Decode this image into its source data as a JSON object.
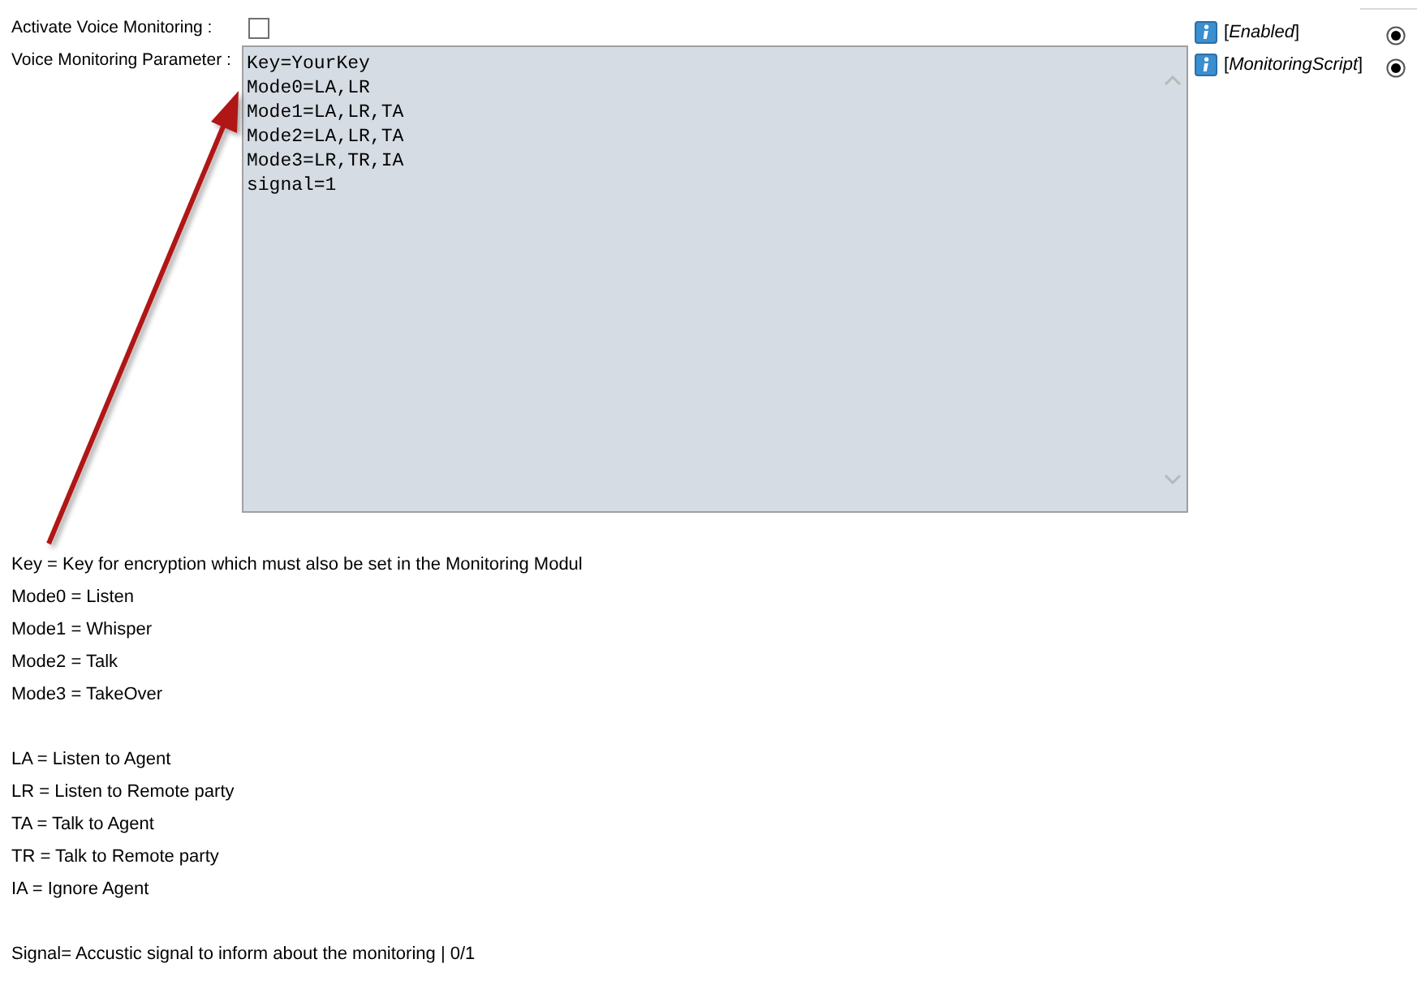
{
  "fields": [
    {
      "kind": "checkbox",
      "label": "Activate Voice Monitoring :",
      "checked": false,
      "binding": "[*Enabled*]",
      "radio_selected": true
    },
    {
      "kind": "textarea",
      "label": "Voice Monitoring Parameter :",
      "value": "Key=YourKey\nMode0=LA,LR\nMode1=LA,LR,TA\nMode2=LA,LR,TA\nMode3=LR,TR,IA\nsignal=1",
      "binding": "[*MonitoringScript*]",
      "radio_selected": true
    }
  ],
  "help_sections": [
    [
      "Key = Key for encryption which must also be set in the Monitoring Modul",
      "Mode0 = Listen",
      "Mode1 = Whisper",
      "Mode2 = Talk",
      "Mode3 = TakeOver"
    ],
    [
      "LA = Listen to Agent",
      "LR = Listen to Remote party",
      "TA = Talk to Agent",
      "TR = Talk to Remote party",
      "IA = Ignore Agent"
    ],
    [
      "Signal= Accustic signal to inform about the monitoring | 0/1"
    ]
  ]
}
